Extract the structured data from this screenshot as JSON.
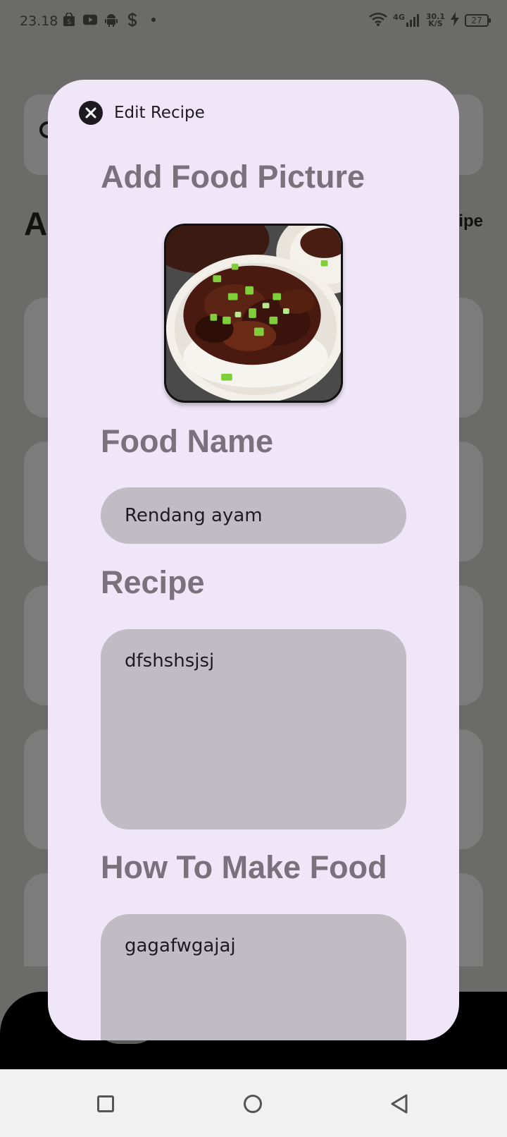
{
  "status_bar": {
    "time": "23.18",
    "network_label": "4G",
    "speed_value": "30.1",
    "speed_unit": "K/S",
    "battery": "27",
    "left_icons": [
      "shop-icon",
      "youtube-icon",
      "android-icon",
      "s-icon",
      "dot-icon"
    ]
  },
  "background_app": {
    "title": "A",
    "add_link": "ipe"
  },
  "dialog": {
    "title": "Edit Recipe",
    "add_picture_label": "Add Food Picture",
    "food_name_label": "Food Name",
    "food_name_value": "Rendang ayam",
    "recipe_label": "Recipe",
    "recipe_value": "dfshshsjsj",
    "how_to_label": "How To Make Food",
    "how_to_value": "gagafwgajaj"
  },
  "colors": {
    "dialog_bg": "#efe6f8",
    "field_bg": "#c0bcc4",
    "label_color": "#77727c",
    "scrim": "#6b6c6a"
  }
}
